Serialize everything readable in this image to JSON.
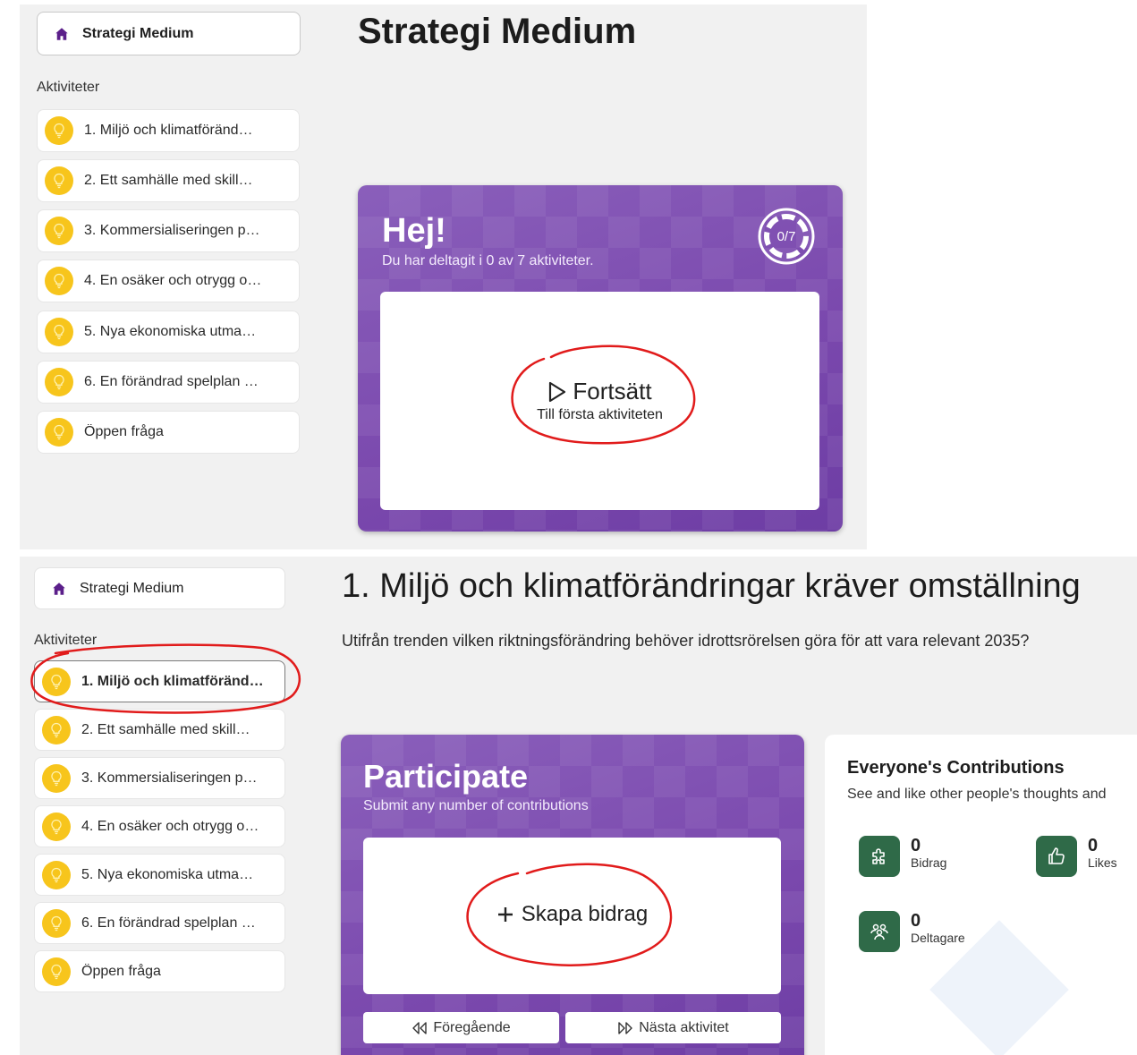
{
  "top": {
    "home_label": "Strategi Medium",
    "section_label": "Aktiviteter",
    "page_title": "Strategi Medium",
    "sidebar_items": [
      {
        "label": "1. Miljö och klimatföränd…"
      },
      {
        "label": "2. Ett samhälle med skill…"
      },
      {
        "label": "3. Kommersialiseringen p…"
      },
      {
        "label": "4. En osäker och otrygg o…"
      },
      {
        "label": "5. Nya ekonomiska utma…"
      },
      {
        "label": "6. En förändrad spelplan …"
      },
      {
        "label": "Öppen fråga"
      }
    ],
    "card": {
      "heading": "Hej!",
      "subheading": "Du har deltagit i 0 av 7 aktiviteter.",
      "progress_text": "0/7",
      "progress_fraction": 0,
      "action_label": "Fortsätt",
      "action_sub": "Till första aktiviteten"
    }
  },
  "bottom": {
    "home_label": "Strategi Medium",
    "section_label": "Aktiviteter",
    "page_title": "1. Miljö och klimatförändringar kräver omställning",
    "question": "Utifrån trenden vilken riktningsförändring behöver idrottsrörelsen göra för att vara relevant 2035?",
    "sidebar_items": [
      {
        "label": "1. Miljö och klimatföränd…",
        "active": true
      },
      {
        "label": "2. Ett samhälle med skill…"
      },
      {
        "label": "3. Kommersialiseringen p…"
      },
      {
        "label": "4. En osäker och otrygg o…"
      },
      {
        "label": "5. Nya ekonomiska utma…"
      },
      {
        "label": "6. En förändrad spelplan …"
      },
      {
        "label": "Öppen fråga"
      }
    ],
    "card": {
      "heading": "Participate",
      "subheading": "Submit any number of contributions",
      "action_label": "Skapa bidrag",
      "prev_label": "Föregående",
      "next_label": "Nästa aktivitet"
    },
    "contributions": {
      "title": "Everyone's Contributions",
      "subtitle": "See and like other people's thoughts and",
      "stats": [
        {
          "value": "0",
          "label": "Bidrag",
          "icon": "puzzle-icon"
        },
        {
          "value": "0",
          "label": "Likes",
          "icon": "thumbs-up-icon"
        },
        {
          "value": "0",
          "label": "Deltagare",
          "icon": "people-icon"
        }
      ]
    }
  },
  "colors": {
    "purple": "#7e4fb0",
    "bulb": "#f7c51c",
    "stat_icon_bg": "#2f6a48",
    "home_icon": "#5b1f8a",
    "annotation": "#e11b1b"
  }
}
